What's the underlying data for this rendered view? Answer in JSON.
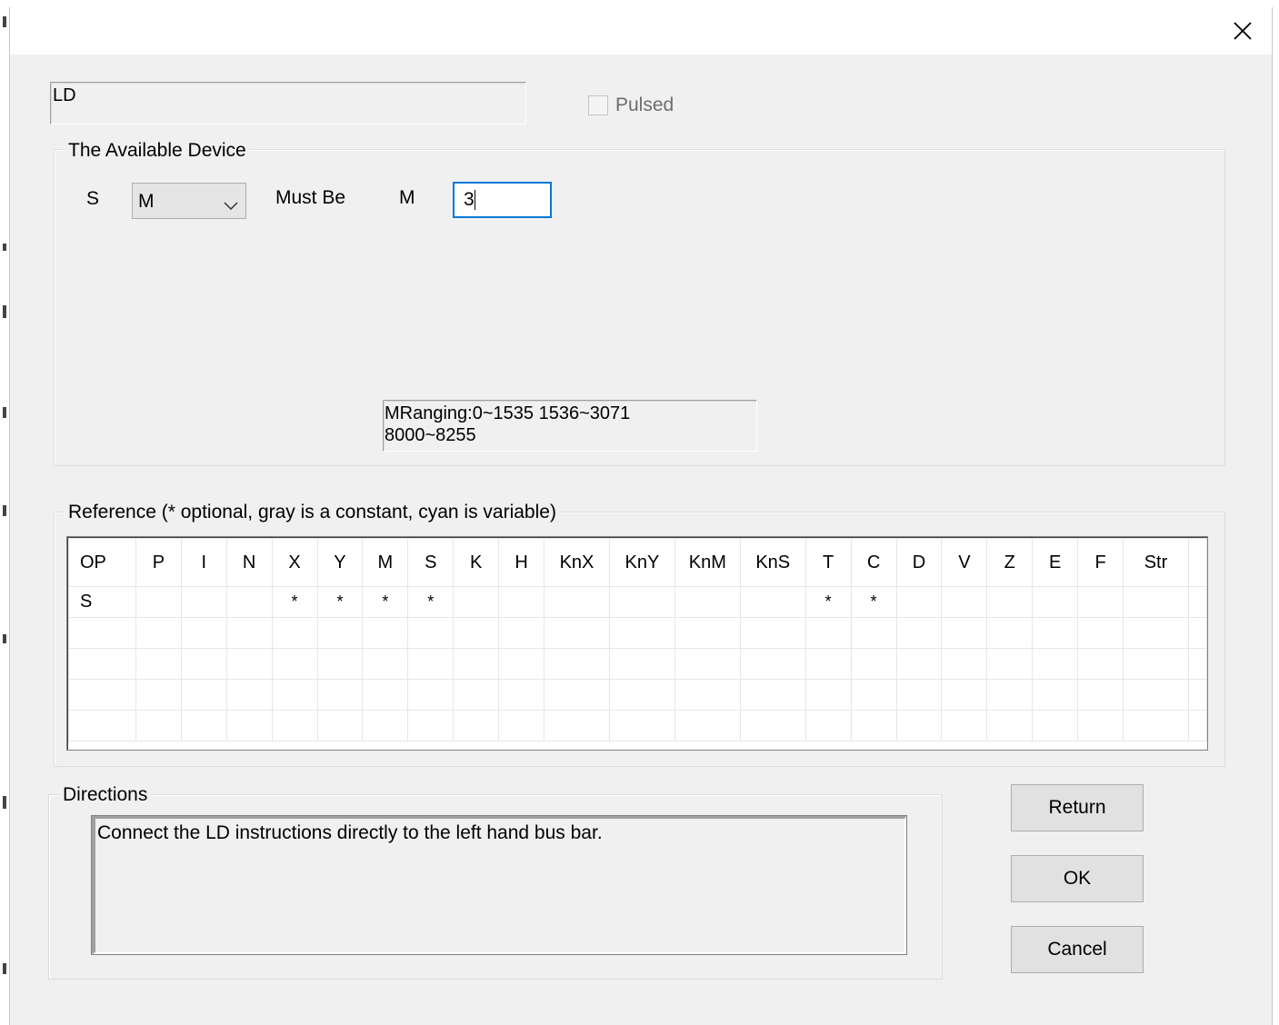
{
  "instruction": {
    "name": "LD",
    "pulsed_label": "Pulsed",
    "pulsed_checked": false
  },
  "device": {
    "group_title": "The Available Device",
    "operand_label": "S",
    "device_select": {
      "value": "M"
    },
    "must_be_label": "Must Be",
    "device_type": "M",
    "address_value": "3",
    "range_line1": "MRanging:0~1535 1536~3071",
    "range_line2": "8000~8255"
  },
  "reference": {
    "title": "Reference (* optional, gray is a constant, cyan is variable)",
    "columns": [
      "OP",
      "P",
      "I",
      "N",
      "X",
      "Y",
      "M",
      "S",
      "K",
      "H",
      "KnX",
      "KnY",
      "KnM",
      "KnS",
      "T",
      "C",
      "D",
      "V",
      "Z",
      "E",
      "F",
      "Str"
    ],
    "rows": [
      [
        "S",
        "",
        "",
        "",
        "*",
        "*",
        "*",
        "*",
        "",
        "",
        "",
        "",
        "",
        "",
        "*",
        "*",
        "",
        "",
        "",
        "",
        "",
        ""
      ]
    ]
  },
  "directions": {
    "title": "Directions",
    "text": "Connect the LD instructions directly to the left hand bus bar."
  },
  "buttons": {
    "return": "Return",
    "ok": "OK",
    "cancel": "Cancel"
  },
  "icons": {
    "close": "close-icon",
    "dropdown": "chevron-down-icon"
  },
  "colors": {
    "focus_border": "#0078d7",
    "dialog_bg": "#f0f0f0"
  }
}
